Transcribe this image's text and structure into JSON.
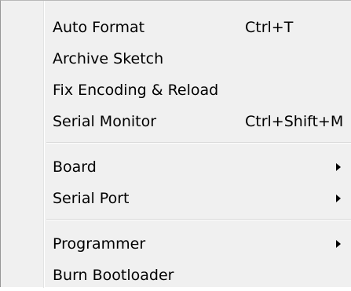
{
  "menu": {
    "groups": [
      {
        "items": [
          {
            "label": "Auto Format",
            "shortcut": "Ctrl+T"
          },
          {
            "label": "Archive Sketch",
            "shortcut": ""
          },
          {
            "label": "Fix Encoding & Reload",
            "shortcut": ""
          },
          {
            "label": "Serial Monitor",
            "shortcut": "Ctrl+Shift+M"
          }
        ]
      },
      {
        "items": [
          {
            "label": "Board",
            "submenu": true
          },
          {
            "label": "Serial Port",
            "submenu": true
          }
        ]
      },
      {
        "items": [
          {
            "label": "Programmer",
            "submenu": true
          },
          {
            "label": "Burn Bootloader",
            "submenu": false
          }
        ]
      }
    ]
  },
  "icons": {
    "submenu_arrow": "submenu-arrow-icon"
  },
  "colors": {
    "menu_background": "#f0f0f0",
    "separator": "#d8d8d8",
    "text": "#000000"
  }
}
